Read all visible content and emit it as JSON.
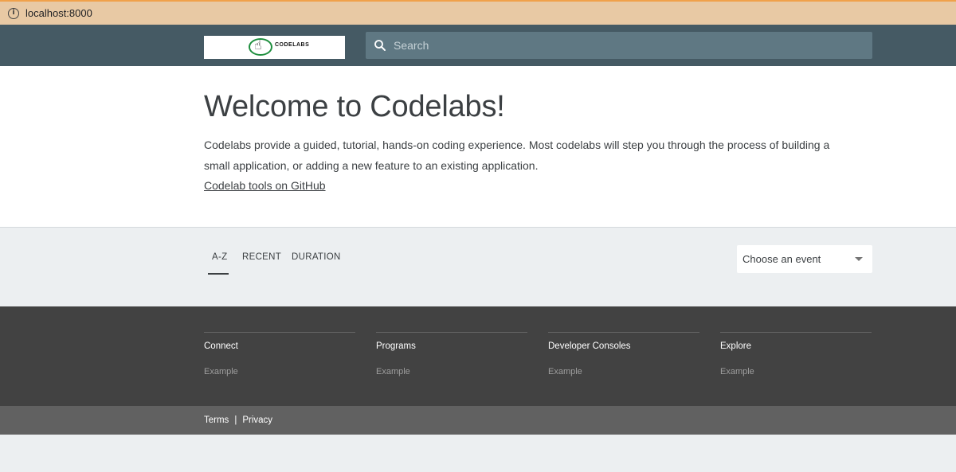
{
  "browser": {
    "url": "localhost:8000"
  },
  "header": {
    "logo_text": "CODELABS",
    "search_placeholder": "Search"
  },
  "hero": {
    "title": "Welcome to Codelabs!",
    "description": "Codelabs provide a guided, tutorial, hands-on coding experience. Most codelabs will step you through the process of building a small application, or adding a new feature to an existing application.",
    "link_text": "Codelab tools on GitHub"
  },
  "filters": {
    "tabs": [
      {
        "label": "A-Z",
        "active": true
      },
      {
        "label": "RECENT",
        "active": false
      },
      {
        "label": "DURATION",
        "active": false
      }
    ],
    "event_select": "Choose an event"
  },
  "footer": {
    "columns": [
      {
        "title": "Connect",
        "link": "Example"
      },
      {
        "title": "Programs",
        "link": "Example"
      },
      {
        "title": "Developer Consoles",
        "link": "Example"
      },
      {
        "title": "Explore",
        "link": "Example"
      }
    ],
    "bottom_links": {
      "terms": "Terms",
      "separator": "|",
      "privacy": "Privacy"
    }
  },
  "colors": {
    "header_bg": "#455a64",
    "search_bg": "#5f7883",
    "footer_bg": "#424242",
    "bottom_bar_bg": "#616161",
    "page_bg": "#eceff1"
  }
}
